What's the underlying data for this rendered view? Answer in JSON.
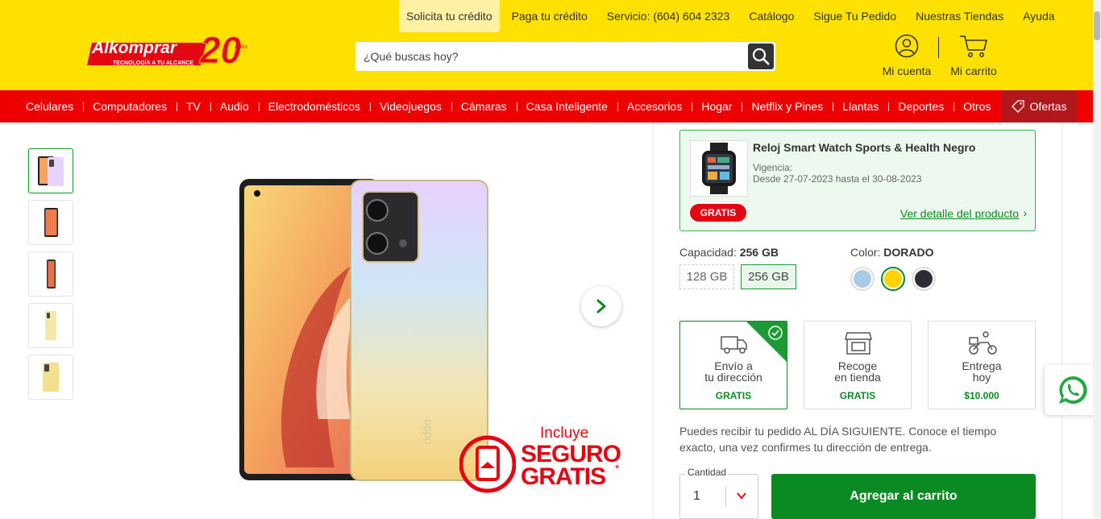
{
  "header": {
    "logo_text": "Alkomprar",
    "logo_tagline": "TECNOLOGÍA A TU ALCANCE",
    "logo_anniversary": "20",
    "logo_anniversary_suffix": "Años",
    "top_links": [
      "Solicita tu crédito",
      "Paga tu crédito",
      "Servicio: (604) 604 2323",
      "Catálogo",
      "Sigue Tu Pedido",
      "Nuestras Tiendas",
      "Ayuda"
    ],
    "search_placeholder": "¿Qué buscas hoy?",
    "account_label": "Mi cuenta",
    "cart_label": "Mi carrito"
  },
  "nav": {
    "items": [
      "Celulares",
      "Computadores",
      "TV",
      "Audio",
      "Electrodomésticos",
      "Videojuegos",
      "Cámaras",
      "Casa Inteligente",
      "Accesorios",
      "Hogar",
      "Netflix y Pines",
      "Llantas",
      "Deportes",
      "Otros"
    ],
    "ofertas_label": "Ofertas"
  },
  "gallery": {
    "thumb_count": 5,
    "seguro_incluye": "Incluye",
    "seguro_line1": "SEGURO",
    "seguro_line2": "GRATIS",
    "seguro_star": "*"
  },
  "gift": {
    "title": "Reloj Smart Watch Sports & Health Negro",
    "vigencia_label": "Vigencia:",
    "dates": "Desde 27-07-2023 hasta el 30-08-2023",
    "badge": "GRATIS",
    "link": "Ver detalle del producto"
  },
  "capacity": {
    "label": "Capacidad:",
    "selected": "256 GB",
    "options": [
      "128 GB",
      "256 GB"
    ]
  },
  "color": {
    "label": "Color:",
    "selected": "DORADO",
    "swatches": [
      "#a9cbe6",
      "#ffd200",
      "#2b2d31"
    ]
  },
  "delivery": [
    {
      "line1": "Envío a",
      "line2": "tu dirección",
      "price": "GRATIS"
    },
    {
      "line1": "Recoge",
      "line2": "en tienda",
      "price": "GRATIS"
    },
    {
      "line1": "Entrega",
      "line2": "hoy",
      "price": "$10.000"
    }
  ],
  "delivery_note": "Puedes recibir tu pedido AL DÍA SIGUIENTE. Conoce el tiempo exacto, una vez confirmes tu dirección de entrega.",
  "quantity": {
    "label": "Cantidad",
    "value": "1"
  },
  "add_to_cart": "Agregar al carrito",
  "colors": {
    "header_yellow": "#ffe100",
    "nav_red": "#ee0000",
    "ofertas_dark_red": "#b2171b",
    "cta_green": "#0a8a22"
  }
}
